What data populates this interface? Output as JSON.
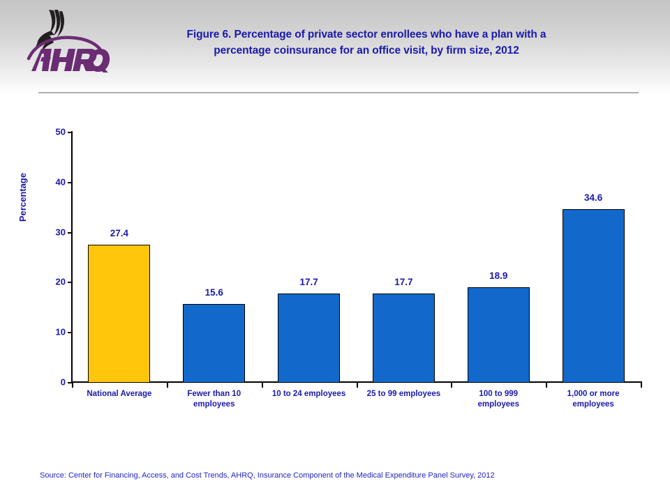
{
  "header": {
    "title": "Figure 6. Percentage of private sector enrollees who have a plan with a percentage coinsurance for an office visit, by firm size, 2012",
    "title_line1": "Figure 6. Percentage of private sector enrollees who have a plan with a",
    "title_line2": "percentage coinsurance for an office visit, by firm size, 2012",
    "logo_text": "AHRQ",
    "logo_icon": "hhs-eagle-icon"
  },
  "source": {
    "text": "Source: Center for Financing, Access, and Cost Trends, AHRQ, Insurance Component of the Medical Expenditure Panel Survey,  2012"
  },
  "colors": {
    "title_blue": "#1a19ad",
    "bar_gold": "#ffc60b",
    "bar_blue": "#1268cb",
    "logo_purple": "#6b2c74",
    "source_blue": "#2222c8"
  },
  "chart_data": {
    "type": "bar",
    "title": "Figure 6. Percentage of private sector enrollees who have a plan with a percentage coinsurance for an office visit, by firm size, 2012",
    "xlabel": "",
    "ylabel": "Percentage",
    "ylim": [
      0,
      50
    ],
    "yticks": [
      0,
      10,
      20,
      30,
      40,
      50
    ],
    "grid": false,
    "legend": "none",
    "categories": [
      "National Average",
      "Fewer than 10 employees",
      "10 to 24 employees",
      "25 to 99 employees",
      "100 to 999 employees",
      "1,000 or more employees"
    ],
    "category_lines": [
      [
        "National Average"
      ],
      [
        "Fewer than 10",
        "employees"
      ],
      [
        "10 to 24 employees"
      ],
      [
        "25 to 99 employees"
      ],
      [
        "100 to 999",
        "employees"
      ],
      [
        "1,000 or more",
        "employees"
      ]
    ],
    "values": [
      27.4,
      15.6,
      17.7,
      17.7,
      18.9,
      34.6
    ],
    "value_labels": [
      "27.4",
      "15.6",
      "17.7",
      "17.7",
      "18.9",
      "34.6"
    ],
    "bar_colors": [
      "#ffc60b",
      "#1268cb",
      "#1268cb",
      "#1268cb",
      "#1268cb",
      "#1268cb"
    ]
  }
}
